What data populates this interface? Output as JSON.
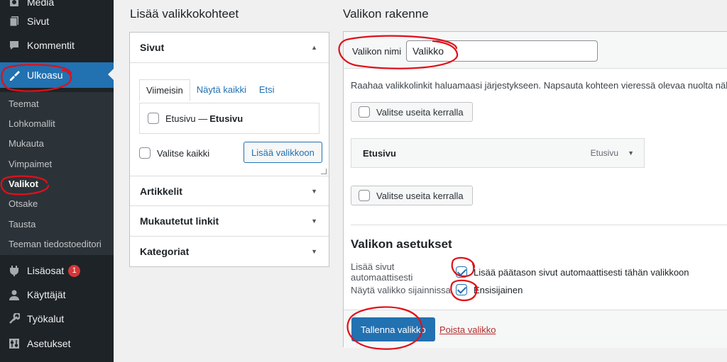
{
  "sidebar": {
    "top_items": [
      {
        "label": "Media",
        "icon": "media-icon"
      },
      {
        "label": "Sivut",
        "icon": "pages-icon"
      },
      {
        "label": "Kommentit",
        "icon": "comments-icon"
      },
      {
        "label": "Ulkoasu",
        "icon": "appearance-brush-icon"
      }
    ],
    "submenu": [
      "Teemat",
      "Lohkomallit",
      "Mukauta",
      "Vimpaimet",
      "Valikot",
      "Otsake",
      "Tausta",
      "Teeman tiedostoeditori"
    ],
    "current_submenu": "Valikot",
    "bottom_items": [
      {
        "label": "Lisäosat",
        "icon": "plugins-icon",
        "badge": "1"
      },
      {
        "label": "Käyttäjät",
        "icon": "users-icon"
      },
      {
        "label": "Työkalut",
        "icon": "tools-icon"
      },
      {
        "label": "Asetukset",
        "icon": "settings-icon"
      }
    ],
    "accent_color": "#2271b1"
  },
  "left": {
    "heading": "Lisää valikkokohteet",
    "sections": [
      {
        "title": "Sivut",
        "expanded": true
      },
      {
        "title": "Artikkelit",
        "expanded": false
      },
      {
        "title": "Mukautetut linkit",
        "expanded": false
      },
      {
        "title": "Kategoriat",
        "expanded": false
      }
    ],
    "tabs": [
      "Viimeisin",
      "Näytä kaikki",
      "Etsi"
    ],
    "active_tab": "Viimeisin",
    "page_item": {
      "label": "Etusivu — ",
      "bold": "Etusivu"
    },
    "select_all": "Valitse kaikki",
    "add_button": "Lisää valikkoon"
  },
  "right": {
    "heading": "Valikon rakenne",
    "name_label": "Valikon nimi",
    "name_value": "Valikko",
    "instructions": "Raahaa valikkolinkit haluamaasi järjestykseen. Napsauta kohteen vieressä olevaa nuolta nähdäksesi",
    "bulk_select": "Valitse useita kerralla",
    "menu_items": [
      {
        "title": "Etusivu",
        "type": "Etusivu"
      }
    ],
    "settings_heading": "Valikon asetukset",
    "settings": [
      {
        "label": "Lisää sivut automaattisesti",
        "value": "Lisää päätason sivut automaattisesti tähän valikkoon",
        "checked": true
      },
      {
        "label": "Näytä valikko sijainnissa",
        "value": "Ensisijainen",
        "checked": true
      }
    ],
    "save_button": "Tallenna valikko",
    "delete_link": "Poista valikko",
    "annotation_color": "#e0101a"
  }
}
